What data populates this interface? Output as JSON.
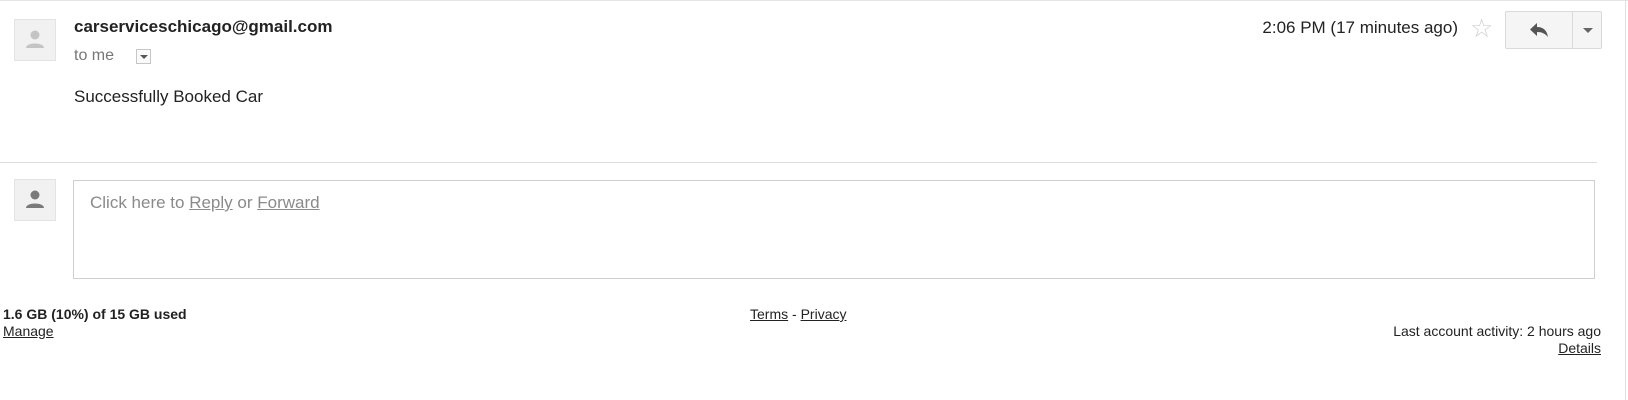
{
  "message": {
    "sender_email": "carserviceschicago@gmail.com",
    "recipient_line": "to me",
    "timestamp": "2:06 PM (17 minutes ago)",
    "body": "Successfully Booked Car"
  },
  "reply_area": {
    "prompt_prefix": "Click here to ",
    "reply_link": "Reply",
    "or_text": " or ",
    "forward_link": "Forward"
  },
  "footer": {
    "storage_text": "1.6 GB (10%) of 15 GB used",
    "manage_link": "Manage",
    "terms_link": "Terms",
    "legal_separator": " - ",
    "privacy_link": "Privacy",
    "activity_text": "Last account activity: 2 hours ago",
    "details_link": "Details"
  },
  "icons": {
    "sender_avatar": "person-icon",
    "reply_avatar": "person-icon",
    "star": "star-outline-icon",
    "reply": "reply-arrow-icon",
    "more": "chevron-down-icon",
    "show_details": "dropdown-arrow-icon"
  },
  "colors": {
    "star_outline": "#cfcfcf",
    "muted_text": "#777777",
    "placeholder_text": "#8a8a8a"
  }
}
